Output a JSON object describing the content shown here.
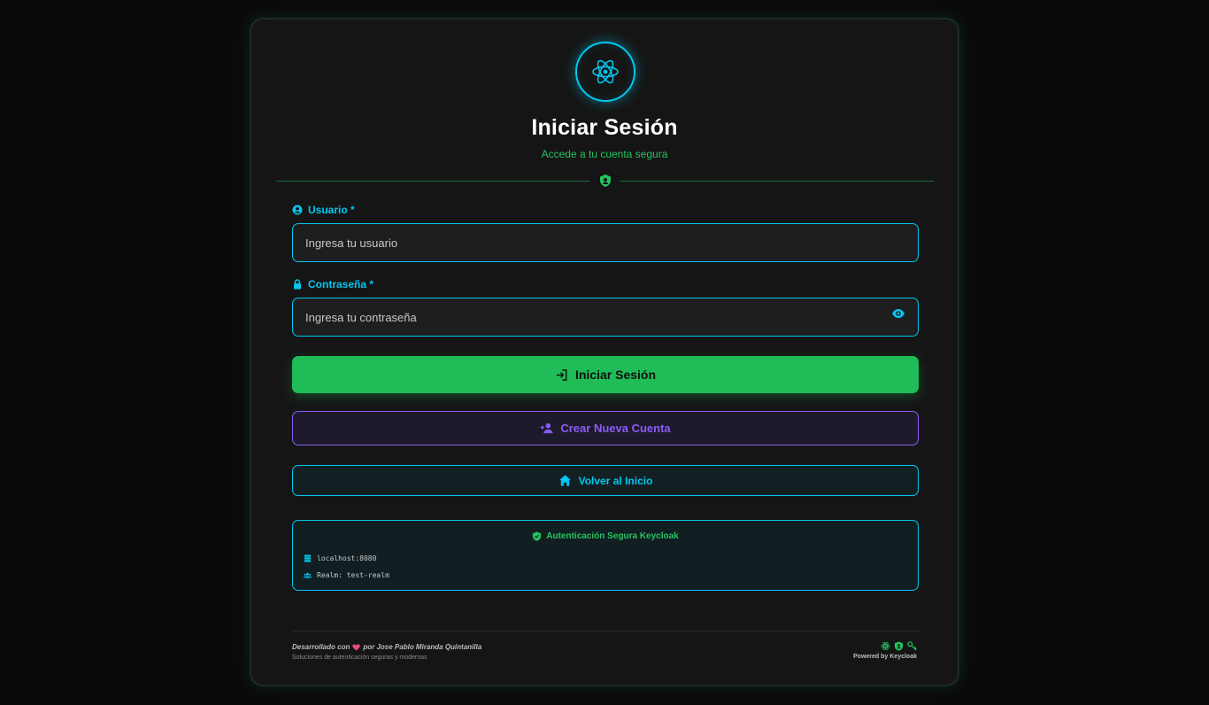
{
  "header": {
    "title": "Iniciar Sesión",
    "subtitle": "Accede a tu cuenta segura",
    "logo_icon": "react-atom-icon",
    "divider_icon": "user-shield-icon"
  },
  "form": {
    "username": {
      "label": "Usuario *",
      "placeholder": "Ingresa tu usuario",
      "value": "",
      "icon": "user-circle-icon"
    },
    "password": {
      "label": "Contraseña *",
      "placeholder": "Ingresa tu contraseña",
      "value": "",
      "icon": "lock-icon",
      "toggle_icon": "eye-icon"
    }
  },
  "buttons": {
    "login": {
      "label": "Iniciar Sesión",
      "icon": "sign-in-icon"
    },
    "register": {
      "label": "Crear Nueva Cuenta",
      "icon": "user-plus-icon"
    },
    "home": {
      "label": "Volver al Inicio",
      "icon": "home-icon"
    }
  },
  "info": {
    "title": "Autenticación Segura Keycloak",
    "server": "localhost:8080",
    "realm": "Realm: test-realm"
  },
  "footer": {
    "credit_prefix": "Desarrollado con",
    "credit_suffix": "por Jose Pablo Miranda Quintanilla",
    "tagline": "Soluciones de autenticación seguras y modernas",
    "powered": "Powered by Keycloak"
  },
  "colors": {
    "accent_cyan": "#00c8f0",
    "accent_green": "#22c55e",
    "accent_purple": "#8b5cf6",
    "background": "#0a0a0a",
    "card": "#151515"
  }
}
